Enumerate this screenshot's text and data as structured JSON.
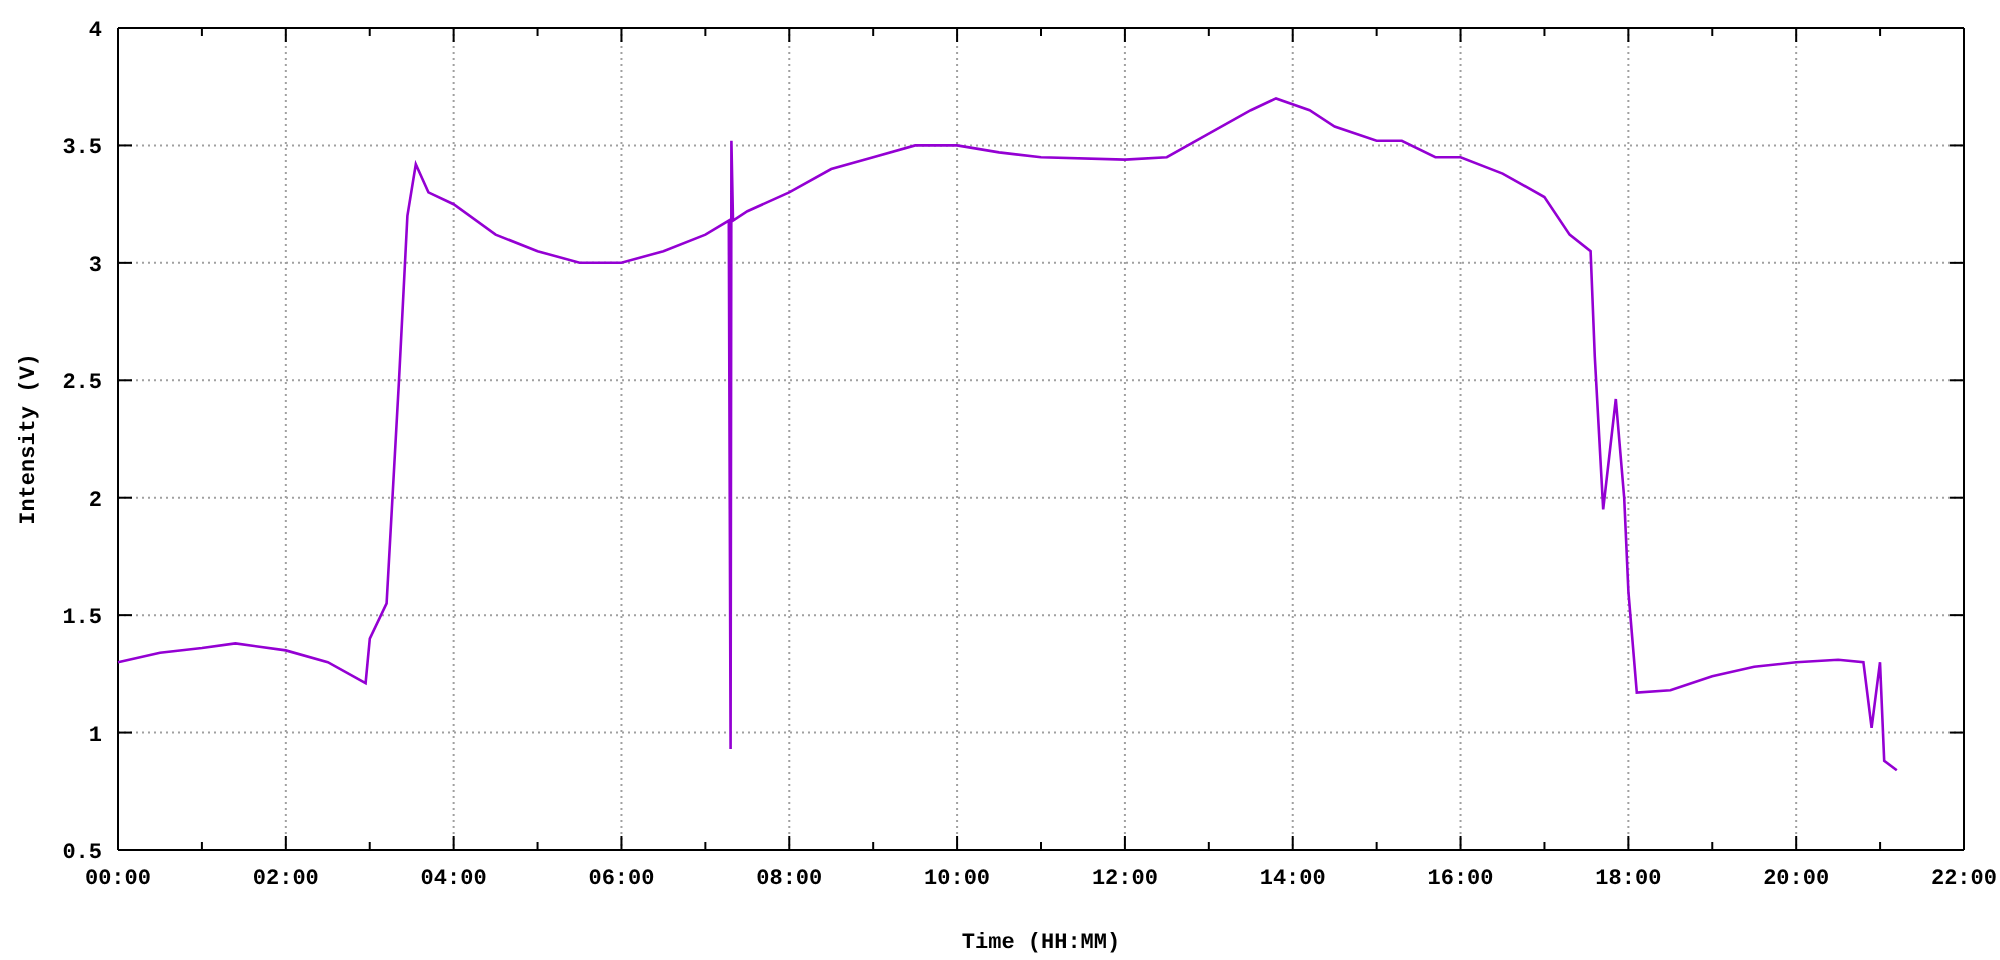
{
  "chart_data": {
    "type": "line",
    "xlabel": "Time (HH:MM)",
    "ylabel": "Intensity (V)",
    "x": [
      0,
      0.5,
      1,
      1.4,
      2,
      2.5,
      2.95,
      3,
      3.2,
      3.35,
      3.45,
      3.55,
      3.7,
      4,
      4.5,
      5,
      5.5,
      6,
      6.5,
      7,
      7.28,
      7.3,
      7.31,
      7.33,
      7.5,
      8,
      8.5,
      9,
      9.5,
      10,
      10.5,
      11,
      12,
      12.5,
      13,
      13.5,
      13.8,
      14.2,
      14.5,
      15,
      15.3,
      15.7,
      16,
      16.5,
      17,
      17.3,
      17.55,
      17.6,
      17.7,
      17.85,
      17.95,
      18,
      18.1,
      18.5,
      19,
      19.5,
      20,
      20.5,
      20.8,
      20.9,
      21,
      21.05,
      21.2
    ],
    "series": [
      {
        "color": "#9400d3",
        "values": [
          1.3,
          1.34,
          1.36,
          1.38,
          1.35,
          1.3,
          1.21,
          1.4,
          1.55,
          2.5,
          3.2,
          3.42,
          3.3,
          3.25,
          3.12,
          3.05,
          3,
          3,
          3.05,
          3.12,
          3.18,
          0.93,
          3.52,
          3.18,
          3.22,
          3.3,
          3.4,
          3.45,
          3.5,
          3.5,
          3.47,
          3.45,
          3.44,
          3.45,
          3.55,
          3.65,
          3.7,
          3.65,
          3.58,
          3.52,
          3.52,
          3.45,
          3.45,
          3.38,
          3.28,
          3.12,
          3.05,
          2.6,
          1.95,
          2.42,
          2,
          1.6,
          1.17,
          1.18,
          1.24,
          1.28,
          1.3,
          1.31,
          1.3,
          1.02,
          1.3,
          0.88,
          0.84
        ]
      }
    ],
    "xlim": [
      0,
      22
    ],
    "ylim": [
      0.5,
      4
    ],
    "xticks": [
      {
        "value": 0,
        "label": "00:00"
      },
      {
        "value": 2,
        "label": "02:00"
      },
      {
        "value": 4,
        "label": "04:00"
      },
      {
        "value": 6,
        "label": "06:00"
      },
      {
        "value": 8,
        "label": "08:00"
      },
      {
        "value": 10,
        "label": "10:00"
      },
      {
        "value": 12,
        "label": "12:00"
      },
      {
        "value": 14,
        "label": "14:00"
      },
      {
        "value": 16,
        "label": "16:00"
      },
      {
        "value": 18,
        "label": "18:00"
      },
      {
        "value": 20,
        "label": "20:00"
      },
      {
        "value": 22,
        "label": "22:00"
      }
    ],
    "yticks": [
      0.5,
      1,
      1.5,
      2,
      2.5,
      3,
      3.5,
      4
    ],
    "grid": true
  }
}
